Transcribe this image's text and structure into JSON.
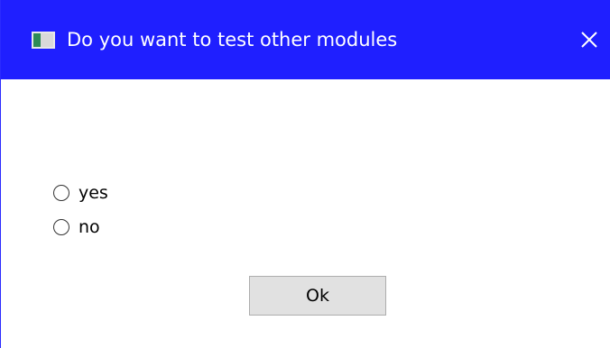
{
  "window": {
    "title": "Do you want to test other modules",
    "titlebar_color": "#1f1fff",
    "app_icon": "window-app-icon",
    "close_icon": "close-icon"
  },
  "options": [
    {
      "label": "yes",
      "selected": false
    },
    {
      "label": "no",
      "selected": false
    }
  ],
  "ok_button": {
    "label": "Ok"
  }
}
